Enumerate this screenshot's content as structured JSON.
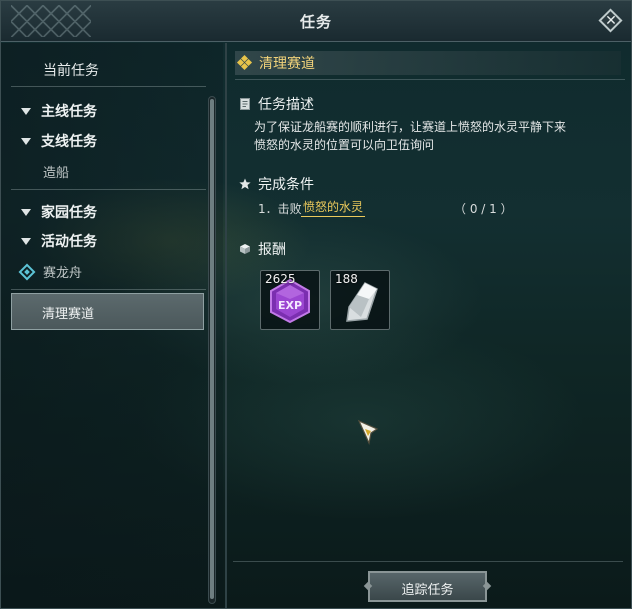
{
  "window": {
    "title": "任务"
  },
  "sidebar": {
    "current_label": "当前任务",
    "sections": [
      {
        "label": "主线任务"
      },
      {
        "label": "支线任务",
        "children": [
          "造船"
        ]
      },
      {
        "label": "家园任务"
      },
      {
        "label": "活动任务",
        "children": [
          "赛龙舟"
        ]
      }
    ],
    "selected_item": "清理赛道"
  },
  "quest": {
    "title": "清理赛道",
    "description_heading": "任务描述",
    "description_line1": "为了保证龙船赛的顺利进行，让赛道上愤怒的水灵平静下来",
    "description_line2": "愤怒的水灵的位置可以向卫伍询问",
    "conditions_heading": "完成条件",
    "condition_index": "1．击败",
    "condition_target": "愤怒的水灵",
    "condition_progress": "（ 0 / 1 ）",
    "rewards_heading": "报酬",
    "rewards": [
      {
        "icon": "exp-crystal-icon",
        "count": "2625"
      },
      {
        "icon": "silver-ore-icon",
        "count": "188"
      }
    ]
  },
  "buttons": {
    "track": "追踪任务"
  },
  "colors": {
    "accent_gold": "#ebc95b",
    "event_icon": "#5cc3d6"
  }
}
